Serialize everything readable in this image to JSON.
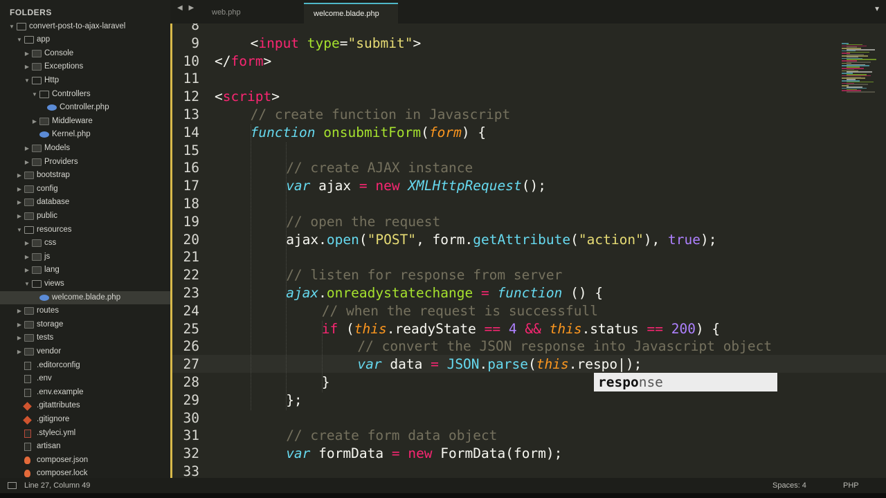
{
  "sidebar": {
    "header": "FOLDERS",
    "items": [
      {
        "label": "convert-post-to-ajax-laravel",
        "level": 0,
        "kind": "folder",
        "open": true
      },
      {
        "label": "app",
        "level": 1,
        "kind": "folder",
        "open": true
      },
      {
        "label": "Console",
        "level": 2,
        "kind": "folder",
        "open": false
      },
      {
        "label": "Exceptions",
        "level": 2,
        "kind": "folder",
        "open": false
      },
      {
        "label": "Http",
        "level": 2,
        "kind": "folder",
        "open": true
      },
      {
        "label": "Controllers",
        "level": 3,
        "kind": "folder",
        "open": true
      },
      {
        "label": "Controller.php",
        "level": 4,
        "kind": "php"
      },
      {
        "label": "Middleware",
        "level": 3,
        "kind": "folder",
        "open": false
      },
      {
        "label": "Kernel.php",
        "level": 3,
        "kind": "php"
      },
      {
        "label": "Models",
        "level": 2,
        "kind": "folder",
        "open": false
      },
      {
        "label": "Providers",
        "level": 2,
        "kind": "folder",
        "open": false
      },
      {
        "label": "bootstrap",
        "level": 1,
        "kind": "folder",
        "open": false
      },
      {
        "label": "config",
        "level": 1,
        "kind": "folder",
        "open": false
      },
      {
        "label": "database",
        "level": 1,
        "kind": "folder",
        "open": false
      },
      {
        "label": "public",
        "level": 1,
        "kind": "folder",
        "open": false
      },
      {
        "label": "resources",
        "level": 1,
        "kind": "folder",
        "open": true
      },
      {
        "label": "css",
        "level": 2,
        "kind": "folder",
        "open": false
      },
      {
        "label": "js",
        "level": 2,
        "kind": "folder",
        "open": false
      },
      {
        "label": "lang",
        "level": 2,
        "kind": "folder",
        "open": false
      },
      {
        "label": "views",
        "level": 2,
        "kind": "folder",
        "open": true
      },
      {
        "label": "welcome.blade.php",
        "level": 3,
        "kind": "php",
        "selected": true
      },
      {
        "label": "routes",
        "level": 1,
        "kind": "folder",
        "open": false
      },
      {
        "label": "storage",
        "level": 1,
        "kind": "folder",
        "open": false
      },
      {
        "label": "tests",
        "level": 1,
        "kind": "folder",
        "open": false
      },
      {
        "label": "vendor",
        "level": 1,
        "kind": "folder",
        "open": false
      },
      {
        "label": ".editorconfig",
        "level": 1,
        "kind": "file"
      },
      {
        "label": ".env",
        "level": 1,
        "kind": "file"
      },
      {
        "label": ".env.example",
        "level": 1,
        "kind": "file"
      },
      {
        "label": ".gitattributes",
        "level": 1,
        "kind": "git"
      },
      {
        "label": ".gitignore",
        "level": 1,
        "kind": "git"
      },
      {
        "label": ".styleci.yml",
        "level": 1,
        "kind": "yml"
      },
      {
        "label": "artisan",
        "level": 1,
        "kind": "file"
      },
      {
        "label": "composer.json",
        "level": 1,
        "kind": "composer"
      },
      {
        "label": "composer.lock",
        "level": 1,
        "kind": "composer"
      }
    ]
  },
  "tabs": [
    {
      "label": "web.php",
      "active": false
    },
    {
      "label": "welcome.blade.php",
      "active": true
    }
  ],
  "nav_arrows": "◀ ▶",
  "tab_dropdown": "▼",
  "editor": {
    "lines": [
      {
        "n": "8",
        "indent": 0,
        "tokens": []
      },
      {
        "n": "9",
        "indent": 4,
        "tokens": [
          [
            "",
            "<"
          ],
          [
            "k-tag",
            "input"
          ],
          [
            "",
            " "
          ],
          [
            "k-attr",
            "type"
          ],
          [
            "",
            "="
          ],
          [
            "k-str",
            "\"submit\""
          ],
          [
            "",
            ">"
          ]
        ]
      },
      {
        "n": "10",
        "indent": 0,
        "tokens": [
          [
            "",
            "</"
          ],
          [
            "k-tag",
            "form"
          ],
          [
            "",
            ">"
          ]
        ]
      },
      {
        "n": "11",
        "indent": 0,
        "tokens": []
      },
      {
        "n": "12",
        "indent": 0,
        "tokens": [
          [
            "",
            "<"
          ],
          [
            "k-tag",
            "script"
          ],
          [
            "",
            ">"
          ]
        ]
      },
      {
        "n": "13",
        "indent": 4,
        "tokens": [
          [
            "k-cmt",
            "// create function in Javascript"
          ]
        ]
      },
      {
        "n": "14",
        "indent": 4,
        "tokens": [
          [
            "k-sto",
            "function"
          ],
          [
            "",
            " "
          ],
          [
            "k-fn",
            "onsubmitForm"
          ],
          [
            "",
            "("
          ],
          [
            "k-param",
            "form"
          ],
          [
            "",
            ") {"
          ]
        ]
      },
      {
        "n": "15",
        "indent": 0,
        "tokens": []
      },
      {
        "n": "16",
        "indent": 8,
        "tokens": [
          [
            "k-cmt",
            "// create AJAX instance"
          ]
        ]
      },
      {
        "n": "17",
        "indent": 8,
        "tokens": [
          [
            "k-sto",
            "var"
          ],
          [
            "",
            " ajax "
          ],
          [
            "k-op",
            "="
          ],
          [
            "",
            " "
          ],
          [
            "k-op",
            "new"
          ],
          [
            "",
            " "
          ],
          [
            "k-cls",
            "XMLHttpRequest"
          ],
          [
            "",
            "();"
          ]
        ]
      },
      {
        "n": "18",
        "indent": 0,
        "tokens": []
      },
      {
        "n": "19",
        "indent": 8,
        "tokens": [
          [
            "k-cmt",
            "// open the request"
          ]
        ]
      },
      {
        "n": "20",
        "indent": 8,
        "tokens": [
          [
            "",
            "ajax."
          ],
          [
            "k-sup",
            "open"
          ],
          [
            "",
            "("
          ],
          [
            "k-str",
            "\"POST\""
          ],
          [
            "",
            ", form."
          ],
          [
            "k-sup",
            "getAttribute"
          ],
          [
            "",
            "("
          ],
          [
            "k-str",
            "\"action\""
          ],
          [
            "",
            "), "
          ],
          [
            "k-const",
            "true"
          ],
          [
            "",
            ");"
          ]
        ]
      },
      {
        "n": "21",
        "indent": 0,
        "tokens": []
      },
      {
        "n": "22",
        "indent": 8,
        "tokens": [
          [
            "k-cmt",
            "// listen for response from server"
          ]
        ]
      },
      {
        "n": "23",
        "indent": 8,
        "tokens": [
          [
            "k-sto",
            "ajax"
          ],
          [
            "",
            "."
          ],
          [
            "k-fn",
            "onreadystatechange"
          ],
          [
            "",
            " "
          ],
          [
            "k-op",
            "="
          ],
          [
            "",
            " "
          ],
          [
            "k-sto",
            "function"
          ],
          [
            "",
            " () {"
          ]
        ]
      },
      {
        "n": "24",
        "indent": 12,
        "tokens": [
          [
            "k-cmt",
            "// when the request is successfull"
          ]
        ]
      },
      {
        "n": "25",
        "indent": 12,
        "tokens": [
          [
            "k-kw",
            "if"
          ],
          [
            "",
            " ("
          ],
          [
            "k-this",
            "this"
          ],
          [
            "",
            ".readyState "
          ],
          [
            "k-op",
            "=="
          ],
          [
            "",
            " "
          ],
          [
            "k-num",
            "4"
          ],
          [
            "",
            " "
          ],
          [
            "k-op",
            "&&"
          ],
          [
            "",
            " "
          ],
          [
            "k-this",
            "this"
          ],
          [
            "",
            ".status "
          ],
          [
            "k-op",
            "=="
          ],
          [
            "",
            " "
          ],
          [
            "k-num",
            "200"
          ],
          [
            "",
            ") {"
          ]
        ]
      },
      {
        "n": "26",
        "indent": 16,
        "tokens": [
          [
            "k-cmt",
            "// convert the JSON response into Javascript object"
          ]
        ]
      },
      {
        "n": "27",
        "indent": 16,
        "tokens": [
          [
            "k-sto",
            "var"
          ],
          [
            "",
            " data "
          ],
          [
            "k-op",
            "="
          ],
          [
            "",
            " "
          ],
          [
            "k-sup",
            "JSON"
          ],
          [
            "",
            "."
          ],
          [
            "k-sup",
            "parse"
          ],
          [
            "",
            "("
          ],
          [
            "k-this",
            "this"
          ],
          [
            "",
            ".respo|);"
          ]
        ]
      },
      {
        "n": "28",
        "indent": 12,
        "tokens": [
          [
            "",
            "}"
          ]
        ]
      },
      {
        "n": "29",
        "indent": 8,
        "tokens": [
          [
            "",
            "};"
          ]
        ]
      },
      {
        "n": "30",
        "indent": 0,
        "tokens": []
      },
      {
        "n": "31",
        "indent": 8,
        "tokens": [
          [
            "k-cmt",
            "// create form data object"
          ]
        ]
      },
      {
        "n": "32",
        "indent": 8,
        "tokens": [
          [
            "k-sto",
            "var"
          ],
          [
            "",
            " formData "
          ],
          [
            "k-op",
            "="
          ],
          [
            "",
            " "
          ],
          [
            "k-op",
            "new"
          ],
          [
            "",
            " FormData(form);"
          ]
        ]
      },
      {
        "n": "33",
        "indent": 0,
        "tokens": []
      }
    ]
  },
  "autocomplete": {
    "match": "respo",
    "rest": "nse"
  },
  "status": {
    "position": "Line 27, Column 49",
    "spaces": "Spaces: 4",
    "syntax": "PHP"
  }
}
